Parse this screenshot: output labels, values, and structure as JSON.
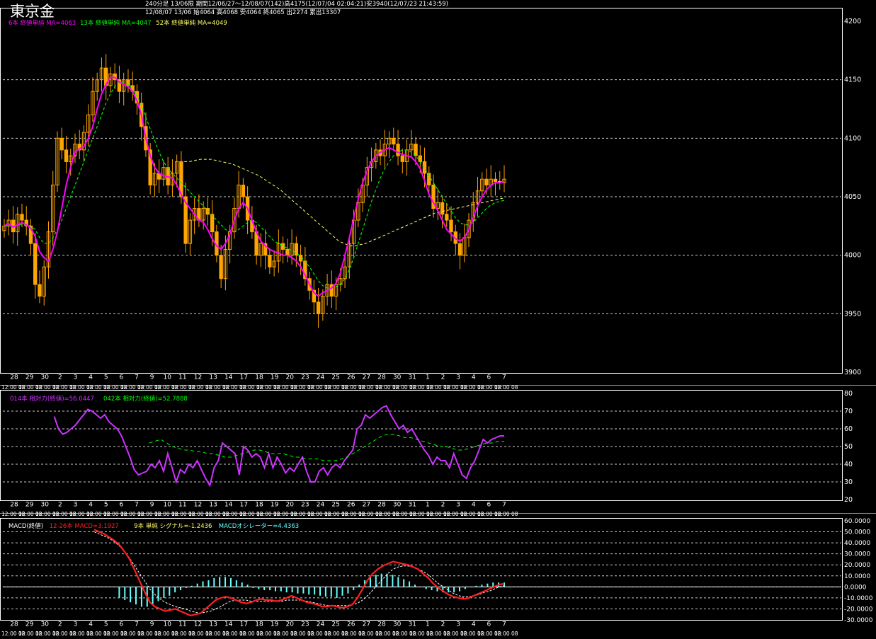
{
  "header": {
    "title": "東京金",
    "line1": "240分足 13/06限 期間12/06/27〜12/08/07(142)高4175(12/07/04 02:04:21)安3940(12/07/23 21:43:59)",
    "line2": "12/08/07 13/06 始4064 高4068 安4064 終4065 出2274 累出13307"
  },
  "colors": {
    "candle": "#ffa500",
    "ma6": "#ff00ff",
    "ma13": "#00ff00",
    "ma52": "#ffff66",
    "rsi14": "#cc33ff",
    "rsi42": "#00ff00",
    "macd": "#ff2020",
    "signal": "#ffffff",
    "osc": "#66ffff",
    "grid": "#ffffff",
    "frame": "#ffffff"
  },
  "x_axis": {
    "day_labels": [
      "28",
      "29",
      "30",
      "2",
      "3",
      "4",
      "5",
      "6",
      "7",
      "9",
      "10",
      "11",
      "12",
      "13",
      "14",
      "17",
      "18",
      "19",
      "20",
      "23",
      "24",
      "25",
      "26",
      "27",
      "28",
      "30",
      "31",
      "1",
      "2",
      "3",
      "4",
      "6",
      "7"
    ],
    "time_label_text": "12:00 08"
  },
  "chart_data": [
    {
      "type": "candlestick",
      "name": "price",
      "ylim": [
        3900,
        4200
      ],
      "y_ticks": [
        3900,
        3950,
        4000,
        4050,
        4100,
        4150,
        4200
      ],
      "legend": [
        {
          "text": "6本 終値単純 MA=4063",
          "color": "#ff00ff"
        },
        {
          "text": "13本 終値単純 MA=4047",
          "color": "#00ff00"
        },
        {
          "text": "52本 終値単純 MA=4049",
          "color": "#ffff66"
        }
      ],
      "closes": [
        4025,
        4030,
        4020,
        4035,
        4030,
        4025,
        4010,
        3975,
        3965,
        3990,
        4020,
        4060,
        4100,
        4090,
        4080,
        4085,
        4095,
        4090,
        4105,
        4120,
        4140,
        4150,
        4160,
        4145,
        4155,
        4150,
        4140,
        4150,
        4145,
        4140,
        4130,
        4110,
        4090,
        4060,
        4070,
        4065,
        4075,
        4060,
        4070,
        4080,
        4050,
        4010,
        4030,
        4040,
        4030,
        4040,
        4035,
        4020,
        4000,
        3980,
        4005,
        4020,
        4040,
        4060,
        4050,
        4030,
        4020,
        4000,
        4010,
        4000,
        3990,
        3995,
        4010,
        4005,
        4000,
        4010,
        4000,
        3995,
        3980,
        3970,
        3960,
        3950,
        3965,
        3975,
        3965,
        3975,
        3980,
        3990,
        4010,
        4030,
        4045,
        4060,
        4075,
        4080,
        4090,
        4085,
        4095,
        4100,
        4095,
        4085,
        4080,
        4090,
        4095,
        4085,
        4080,
        4070,
        4060,
        4040,
        4045,
        4035,
        4030,
        4020,
        4010,
        4000,
        4015,
        4030,
        4045,
        4055,
        4065,
        4060,
        4065,
        4063,
        4062,
        4065
      ],
      "ma6": [
        4025,
        4027,
        4024,
        4026,
        4028,
        4026,
        4023,
        4016,
        4003,
        3998,
        3995,
        4005,
        4020,
        4040,
        4060,
        4075,
        4088,
        4091,
        4093,
        4100,
        4110,
        4125,
        4138,
        4146,
        4152,
        4152,
        4148,
        4146,
        4144,
        4140,
        4132,
        4120,
        4100,
        4085,
        4075,
        4070,
        4068,
        4067,
        4066,
        4060,
        4052,
        4045,
        4040,
        4035,
        4030,
        4028,
        4022,
        4014,
        4008,
        4005,
        4010,
        4018,
        4030,
        4040,
        4045,
        4040,
        4030,
        4020,
        4012,
        4008,
        4005,
        4003,
        4002,
        4000,
        4000,
        3998,
        3995,
        3990,
        3983,
        3975,
        3968,
        3965,
        3968,
        3970,
        3972,
        3976,
        3985,
        4000,
        4015,
        4032,
        4048,
        4062,
        4072,
        4080,
        4085,
        4088,
        4090,
        4092,
        4090,
        4088,
        4086,
        4085,
        4084,
        4080,
        4074,
        4064,
        4052,
        4045,
        4038,
        4030,
        4022,
        4018,
        4014,
        4012,
        4015,
        4022,
        4032,
        4042,
        4050,
        4056,
        4060,
        4062,
        4062,
        4063
      ],
      "ma13": [
        4025,
        4025,
        4025,
        4026,
        4026,
        4026,
        4025,
        4022,
        4015,
        4010,
        4010,
        4015,
        4022,
        4030,
        4040,
        4050,
        4060,
        4070,
        4080,
        4090,
        4100,
        4110,
        4120,
        4130,
        4138,
        4144,
        4148,
        4148,
        4146,
        4142,
        4136,
        4128,
        4118,
        4108,
        4098,
        4088,
        4080,
        4074,
        4070,
        4066,
        4062,
        4058,
        4054,
        4050,
        4046,
        4042,
        4038,
        4034,
        4030,
        4026,
        4022,
        4020,
        4020,
        4022,
        4025,
        4028,
        4030,
        4028,
        4024,
        4020,
        4016,
        4012,
        4010,
        4008,
        4006,
        4004,
        4002,
        3999,
        3995,
        3990,
        3984,
        3978,
        3974,
        3972,
        3972,
        3973,
        3975,
        3980,
        3988,
        3998,
        4010,
        4022,
        4034,
        4046,
        4056,
        4066,
        4074,
        4080,
        4085,
        4088,
        4090,
        4090,
        4088,
        4085,
        4080,
        4074,
        4068,
        4062,
        4056,
        4050,
        4044,
        4038,
        4032,
        4028,
        4026,
        4026,
        4028,
        4032,
        4036,
        4040,
        4043,
        4045,
        4046,
        4047
      ],
      "ma52": [
        4080,
        4080,
        4081,
        4082,
        4082,
        4082,
        4081,
        4080,
        4079,
        4078,
        4076,
        4074,
        4072,
        4070,
        4068,
        4065,
        4062,
        4059,
        4056,
        4052,
        4048,
        4044,
        4040,
        4036,
        4032,
        4028,
        4024,
        4020,
        4016,
        4012,
        4010,
        4008,
        4008,
        4009,
        4010,
        4012,
        4014,
        4016,
        4018,
        4020,
        4022,
        4024,
        4026,
        4028,
        4030,
        4032,
        4034,
        4036,
        4037,
        4038,
        4039,
        4040,
        4041,
        4042,
        4043,
        4044,
        4045,
        4046,
        4047,
        4048,
        4049
      ]
    },
    {
      "type": "line",
      "name": "rsi",
      "ylim": [
        20,
        80
      ],
      "y_ticks": [
        20,
        30,
        40,
        50,
        60,
        70,
        80
      ],
      "legend": [
        {
          "text": "014本 相対力(終値)=56.0447",
          "color": "#cc33ff"
        },
        {
          "text": "042本 相対力(終値)=52.7888",
          "color": "#00ff00"
        }
      ],
      "rsi14": [
        67,
        60,
        57,
        58,
        60,
        62,
        65,
        68,
        71,
        70,
        68,
        66,
        68,
        64,
        62,
        60,
        56,
        50,
        44,
        37,
        34,
        35,
        36,
        40,
        38,
        42,
        36,
        46,
        38,
        30,
        37,
        35,
        40,
        38,
        42,
        37,
        32,
        28,
        38,
        42,
        52,
        50,
        48,
        46,
        34,
        50,
        48,
        44,
        46,
        44,
        38,
        46,
        38,
        44,
        40,
        35,
        38,
        36,
        40,
        44,
        36,
        30,
        30,
        36,
        38,
        34,
        38,
        40,
        38,
        42,
        45,
        48,
        60,
        62,
        68,
        66,
        68,
        70,
        72,
        73,
        68,
        64,
        60,
        62,
        58,
        60,
        56,
        52,
        48,
        45,
        40,
        44,
        42,
        42,
        38,
        46,
        40,
        34,
        32,
        38,
        42,
        48,
        54,
        52,
        54,
        55,
        56,
        56
      ],
      "rsi42": [
        52,
        53,
        54,
        52,
        50,
        49,
        48,
        48,
        47,
        47,
        46,
        46,
        45,
        44,
        44,
        45,
        46,
        47,
        48,
        48,
        47,
        46,
        46,
        46,
        45,
        44,
        44,
        43,
        43,
        43,
        42,
        42,
        42,
        43,
        44,
        46,
        48,
        50,
        52,
        54,
        56,
        57,
        57,
        56,
        55,
        55,
        54,
        53,
        52,
        51,
        50,
        50,
        49,
        48,
        48,
        49,
        50,
        51,
        52,
        52,
        53,
        53
      ]
    },
    {
      "type": "line+histogram",
      "name": "macd",
      "ylim": [
        -30,
        60
      ],
      "y_ticks": [
        60,
        50,
        40,
        30,
        20,
        10,
        0,
        -10,
        -20,
        -30
      ],
      "y_tick_labels": [
        "60.0000",
        "50.0000",
        "40.0000",
        "30.0000",
        "20.0000",
        "10.0000",
        "0.0000",
        "-10.0000",
        "-20.0000",
        "-30.0000"
      ],
      "legend": [
        {
          "text": "MACD(終値)",
          "color": "#ffffff"
        },
        {
          "text": "12-26本 MACD=3.1927",
          "color": "#ff2020"
        },
        {
          "text": "9本 単純 シグナル=-1.2436",
          "color": "#ffff66"
        },
        {
          "text": "MACDオシレーター=4.4363",
          "color": "#66ffff"
        }
      ],
      "macd": [
        52,
        50,
        48,
        45,
        42,
        38,
        32,
        25,
        15,
        5,
        -5,
        -14,
        -18,
        -20,
        -22,
        -21,
        -20,
        -22,
        -24,
        -26,
        -25,
        -24,
        -20,
        -16,
        -12,
        -10,
        -9,
        -10,
        -12,
        -14,
        -15,
        -14,
        -12,
        -11,
        -12,
        -12,
        -13,
        -12,
        -10,
        -8,
        -10,
        -12,
        -14,
        -15,
        -16,
        -18,
        -18,
        -17,
        -18,
        -19,
        -18,
        -16,
        -10,
        -2,
        6,
        12,
        16,
        19,
        21,
        23,
        22,
        21,
        20,
        18,
        16,
        12,
        8,
        3,
        -1,
        -4,
        -7,
        -9,
        -10,
        -11,
        -10,
        -8,
        -6,
        -4,
        -2,
        0,
        2,
        3
      ],
      "signal": [
        50,
        48,
        46,
        44,
        41,
        37,
        32,
        26,
        19,
        12,
        5,
        -2,
        -7,
        -11,
        -14,
        -16,
        -18,
        -19,
        -20,
        -22,
        -23,
        -24,
        -23,
        -22,
        -20,
        -18,
        -15,
        -13,
        -12,
        -12,
        -12,
        -13,
        -13,
        -13,
        -13,
        -13,
        -13,
        -13,
        -12,
        -12,
        -12,
        -12,
        -13,
        -14,
        -15,
        -16,
        -17,
        -17,
        -17,
        -17,
        -17,
        -16,
        -15,
        -12,
        -8,
        -3,
        2,
        7,
        12,
        16,
        18,
        19,
        19,
        18,
        16,
        14,
        11,
        7,
        3,
        0,
        -3,
        -6,
        -8,
        -9,
        -9,
        -8,
        -7,
        -5,
        -4,
        -2,
        0,
        1
      ],
      "oscillator": [
        -10,
        -12,
        -14,
        -16,
        -18,
        -18,
        -16,
        -13,
        -10,
        -8,
        -5,
        -3,
        -1,
        1,
        3,
        5,
        6,
        8,
        9,
        9,
        8,
        6,
        4,
        2,
        -1,
        -2,
        -3,
        -3,
        -4,
        -4,
        -5,
        -5,
        -6,
        -6,
        -7,
        -7,
        -8,
        -9,
        -9,
        -10,
        -8,
        -6,
        -3,
        2,
        6,
        9,
        11,
        12,
        12,
        11,
        9,
        7,
        5,
        2,
        0,
        -2,
        -3,
        -4,
        -5,
        -5,
        -5,
        -4,
        -2,
        0,
        1,
        2,
        3,
        4,
        4,
        4
      ]
    }
  ]
}
